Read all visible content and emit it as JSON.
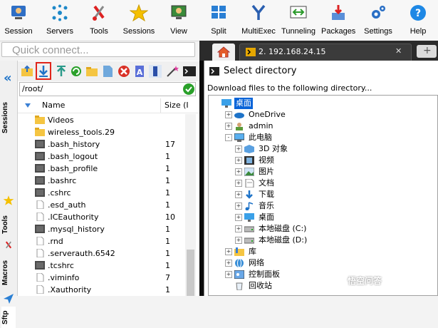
{
  "toolbar": {
    "items": [
      {
        "label": "Session",
        "icon": "session-icon"
      },
      {
        "label": "Servers",
        "icon": "servers-icon"
      },
      {
        "label": "Tools",
        "icon": "tools-icon"
      },
      {
        "label": "Sessions",
        "icon": "star-icon"
      },
      {
        "label": "View",
        "icon": "view-icon"
      },
      {
        "label": "Split",
        "icon": "split-icon"
      },
      {
        "label": "MultiExec",
        "icon": "multiexec-icon"
      },
      {
        "label": "Tunneling",
        "icon": "tunneling-icon"
      },
      {
        "label": "Packages",
        "icon": "packages-icon"
      },
      {
        "label": "Settings",
        "icon": "gear-icon"
      },
      {
        "label": "Help",
        "icon": "help-icon"
      }
    ]
  },
  "quick_connect": {
    "placeholder": "Quick connect..."
  },
  "tabs": {
    "ssh_tab_label": "2. 192.168.24.15",
    "close": "✕",
    "plus": "+"
  },
  "side_tabs": [
    "Sessions",
    "Tools",
    "Macros",
    "Sftp"
  ],
  "sftp": {
    "path": "/root/",
    "columns": {
      "name": "Name",
      "size": "Size (I"
    },
    "files": [
      {
        "name": "Videos",
        "size": "",
        "type": "folder"
      },
      {
        "name": "wireless_tools.29",
        "size": "",
        "type": "folder"
      },
      {
        "name": ".bash_history",
        "size": "17",
        "type": "file-dark"
      },
      {
        "name": ".bash_logout",
        "size": "1",
        "type": "file-dark"
      },
      {
        "name": ".bash_profile",
        "size": "1",
        "type": "file-dark"
      },
      {
        "name": ".bashrc",
        "size": "1",
        "type": "file-dark"
      },
      {
        "name": ".cshrc",
        "size": "1",
        "type": "file-dark"
      },
      {
        "name": ".esd_auth",
        "size": "1",
        "type": "file"
      },
      {
        "name": ".ICEauthority",
        "size": "10",
        "type": "file"
      },
      {
        "name": ".mysql_history",
        "size": "1",
        "type": "file-dark"
      },
      {
        "name": ".rnd",
        "size": "1",
        "type": "file"
      },
      {
        "name": ".serverauth.6542",
        "size": "1",
        "type": "file"
      },
      {
        "name": ".tcshrc",
        "size": "1",
        "type": "file-dark"
      },
      {
        "name": ".viminfo",
        "size": "7",
        "type": "file"
      },
      {
        "name": ".Xauthority",
        "size": "1",
        "type": "file"
      }
    ]
  },
  "dialog": {
    "title": "Select directory",
    "subtitle": "Download files to the following directory...",
    "tree": [
      {
        "label": "桌面",
        "level": 0,
        "selected": true,
        "icon": "desktop-icon",
        "exp": ""
      },
      {
        "label": "OneDrive",
        "level": 1,
        "icon": "cloud-icon",
        "exp": "+"
      },
      {
        "label": "admin",
        "level": 1,
        "icon": "user-icon",
        "exp": "+"
      },
      {
        "label": "此电脑",
        "level": 1,
        "icon": "computer-icon",
        "exp": "-"
      },
      {
        "label": "3D 对象",
        "level": 2,
        "icon": "3d-objects-icon",
        "exp": "+"
      },
      {
        "label": "视频",
        "level": 2,
        "icon": "video-icon",
        "exp": "+"
      },
      {
        "label": "图片",
        "level": 2,
        "icon": "pictures-icon",
        "exp": "+"
      },
      {
        "label": "文档",
        "level": 2,
        "icon": "document-icon",
        "exp": "+"
      },
      {
        "label": "下载",
        "level": 2,
        "icon": "download-icon",
        "exp": "+"
      },
      {
        "label": "音乐",
        "level": 2,
        "icon": "music-icon",
        "exp": "+"
      },
      {
        "label": "桌面",
        "level": 2,
        "icon": "desktop-icon",
        "exp": "+"
      },
      {
        "label": "本地磁盘 (C:)",
        "level": 2,
        "icon": "drive-icon",
        "exp": "+"
      },
      {
        "label": "本地磁盘 (D:)",
        "level": 2,
        "icon": "drive-icon",
        "exp": "+"
      },
      {
        "label": "库",
        "level": 1,
        "icon": "library-icon",
        "exp": "+"
      },
      {
        "label": "网络",
        "level": 1,
        "icon": "network-icon",
        "exp": "+"
      },
      {
        "label": "控制面板",
        "level": 1,
        "icon": "control-panel-icon",
        "exp": "+"
      },
      {
        "label": "回收站",
        "level": 1,
        "icon": "recycle-bin-icon",
        "exp": ""
      }
    ]
  },
  "watermark": "悟空问答",
  "colors": {
    "accent": "#1e88e5",
    "selected": "#cce8ff",
    "folder": "#f5c542",
    "highlight_box": "#e0251b"
  }
}
